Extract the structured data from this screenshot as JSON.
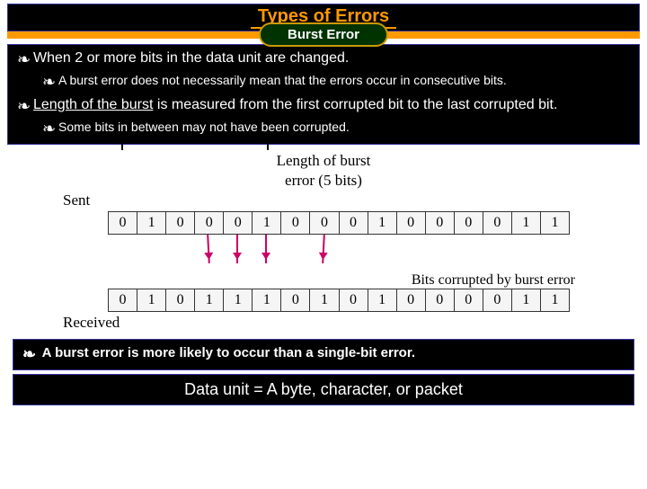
{
  "title": "Types of Errors",
  "subtitle": "Burst Error",
  "point1": "When 2 or more bits in the data unit are changed.",
  "point1a": "A burst error does not necessarily mean that the errors occur in consecutive bits.",
  "point2_u": "Length of the burst",
  "point2_rest": " is measured from the first corrupted bit to the last corrupted bit.",
  "point2a": "Some bits in between may not have been corrupted.",
  "diagram": {
    "brace_label1": "Length of burst",
    "brace_label2": "error (5 bits)",
    "sent_label": "Sent",
    "sent_bits": [
      "0",
      "1",
      "0",
      "0",
      "0",
      "1",
      "0",
      "0",
      "0",
      "1",
      "0",
      "0",
      "0",
      "0",
      "1",
      "1"
    ],
    "corrupt_label": "Bits corrupted by burst error",
    "recv_bits": [
      "0",
      "1",
      "0",
      "1",
      "1",
      "1",
      "0",
      "1",
      "0",
      "1",
      "0",
      "0",
      "0",
      "0",
      "1",
      "1"
    ],
    "recv_label": "Received"
  },
  "bottom1": "A burst error is more likely to occur than a single-bit error.",
  "bottom2": "Data unit  = A byte, character, or packet"
}
